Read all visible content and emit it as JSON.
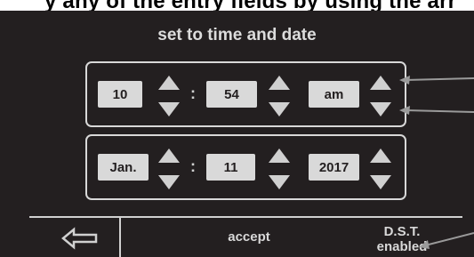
{
  "top_text": "y any of the entry fields by using the arr",
  "title": "set to time and date",
  "time": {
    "hour": "10",
    "separator": ":",
    "minute": "54",
    "meridiem": "am"
  },
  "date": {
    "month": "Jan.",
    "separator": ":",
    "day": "11",
    "year": "2017"
  },
  "footer": {
    "back_icon": "left-arrow-outline-icon",
    "accept_label": "accept",
    "dst_line1": "D.S.T.",
    "dst_line2": "enabled"
  },
  "colors": {
    "screen_bg": "#231f20",
    "field_bg": "#d9d9d9",
    "line_color": "#d0d0d0",
    "callout_color": "#9a9a9a"
  }
}
